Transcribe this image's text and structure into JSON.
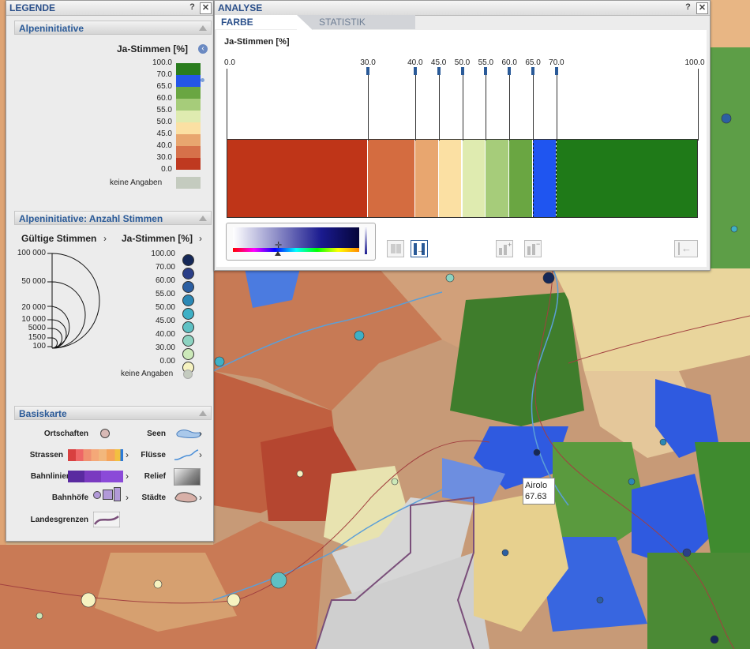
{
  "legend": {
    "title": "LEGENDE",
    "help": "?",
    "close": "✕",
    "section1": {
      "title": "Alpeninitiative",
      "heading": "Ja-Stimmen [%]",
      "ticks": [
        "100.0",
        "70.0",
        "65.0",
        "60.0",
        "55.0",
        "50.0",
        "45.0",
        "40.0",
        "30.0",
        "0.0"
      ],
      "colors": [
        "#2a7d1e",
        "#2456e8",
        "#6aa642",
        "#a6cc7a",
        "#dfebb0",
        "#fbe0a3",
        "#e8a66f",
        "#d6714a",
        "#bf3920"
      ],
      "no_data": "keine Angaben",
      "no_data_color": "#c4cbbf"
    },
    "section2": {
      "title": "Alpeninitiative: Anzahl Stimmen",
      "gueltige": "Gültige Stimmen",
      "ja": "Ja-Stimmen [%]",
      "size_labels": [
        "100 000",
        "50 000",
        "20 000",
        "10 000",
        "5000",
        "1500",
        "100"
      ],
      "color_labels": [
        "100.00",
        "70.00",
        "60.00",
        "55.00",
        "50.00",
        "45.00",
        "40.00",
        "30.00",
        "0.00"
      ],
      "circle_colors": [
        "#152858",
        "#2b3f88",
        "#2c5fa2",
        "#2b88b5",
        "#3fb0c6",
        "#5fc1c4",
        "#8dd3c1",
        "#cce9b9",
        "#f6f2c0"
      ],
      "no_data": "keine Angaben",
      "no_data_color": "#c4cbbf"
    },
    "section3": {
      "title": "Basiskarte",
      "ortschaften": "Ortschaften",
      "seen": "Seen",
      "strassen": "Strassen",
      "fluesse": "Flüsse",
      "bahnlinien": "Bahnlinien",
      "relief": "Relief",
      "bahnhoefe": "Bahnhöfe",
      "staedte": "Städte",
      "landesgrenzen": "Landesgrenzen"
    }
  },
  "analyse": {
    "title": "ANALYSE",
    "help": "?",
    "close": "✕",
    "tabs": [
      "FARBE",
      "STATISTIK"
    ],
    "chart_label": "Ja-Stimmen [%]",
    "scale_labels": [
      "0.0",
      "30.0",
      "40.0",
      "45.0",
      "50.0",
      "55.0",
      "60.0",
      "65.0",
      "70.0",
      "100.0"
    ],
    "classes": [
      {
        "from": 0,
        "to": 30,
        "color": "#bf3518"
      },
      {
        "from": 30,
        "to": 40,
        "color": "#d46c40"
      },
      {
        "from": 40,
        "to": 45,
        "color": "#e8a66f"
      },
      {
        "from": 45,
        "to": 50,
        "color": "#fbe0a3"
      },
      {
        "from": 50,
        "to": 55,
        "color": "#dfebb0"
      },
      {
        "from": 55,
        "to": 60,
        "color": "#a6cc7a"
      },
      {
        "from": 60,
        "to": 65,
        "color": "#6aa642"
      },
      {
        "from": 65,
        "to": 70,
        "color": "#1f55f0"
      },
      {
        "from": 70,
        "to": 100,
        "color": "#1f7a18"
      }
    ]
  },
  "map": {
    "tooltip_name": "Airolo",
    "tooltip_value": "67.63"
  }
}
